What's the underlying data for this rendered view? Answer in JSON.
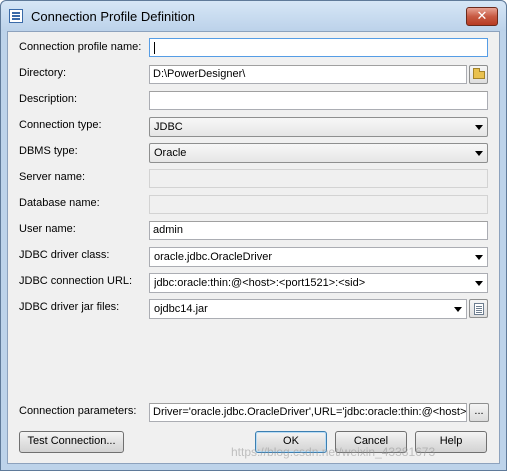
{
  "window": {
    "title": "Connection Profile Definition",
    "close_label": "✕"
  },
  "form": {
    "profile_name": {
      "label": "Connection profile name:",
      "value": ""
    },
    "directory": {
      "label": "Directory:",
      "value": "D:\\PowerDesigner\\"
    },
    "description": {
      "label": "Description:",
      "value": ""
    },
    "connection_type": {
      "label": "Connection type:",
      "value": "JDBC"
    },
    "dbms_type": {
      "label": "DBMS type:",
      "value": "Oracle"
    },
    "server_name": {
      "label": "Server name:",
      "value": ""
    },
    "database_name": {
      "label": "Database name:",
      "value": ""
    },
    "user_name": {
      "label": "User name:",
      "value": "admin"
    },
    "driver_class": {
      "label": "JDBC driver class:",
      "value": "oracle.jdbc.OracleDriver"
    },
    "connection_url": {
      "label": "JDBC connection URL:",
      "value": "jdbc:oracle:thin:@<host>:<port1521>:<sid>"
    },
    "driver_jar": {
      "label": "JDBC driver jar files:",
      "value": "ojdbc14.jar"
    },
    "connection_parameters": {
      "label": "Connection parameters:",
      "value": "Driver='oracle.jdbc.OracleDriver',URL='jdbc:oracle:thin:@<host>:<"
    }
  },
  "buttons": {
    "test_connection": "Test Connection...",
    "ok": "OK",
    "cancel": "Cancel",
    "help": "Help",
    "ellipsis": "..."
  },
  "icons": {
    "app": "app-icon",
    "browse_directory": "folder-icon",
    "browse_jar": "document-icon"
  },
  "watermark": "https://blog.csdn.net/weixin_43381673"
}
